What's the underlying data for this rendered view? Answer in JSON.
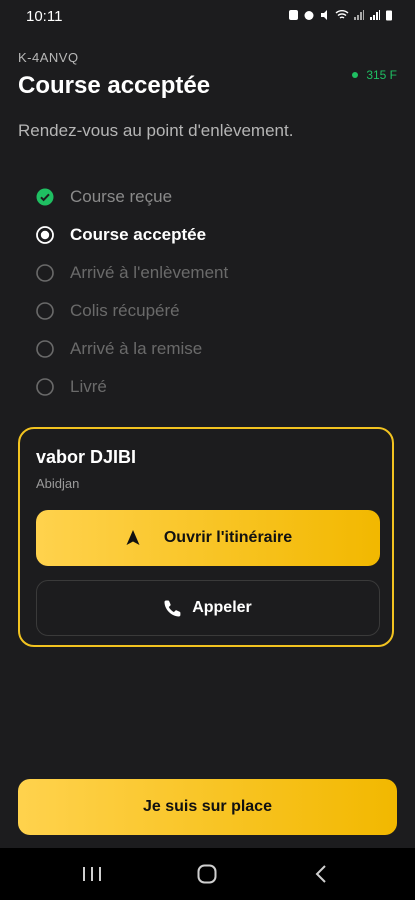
{
  "status_bar": {
    "time": "10:11"
  },
  "header": {
    "reference": "K-4ANVQ",
    "title": "Course acceptée",
    "balance": "315 F",
    "subtitle": "Rendez-vous au point d'enlèvement."
  },
  "steps": [
    {
      "label": "Course reçue",
      "state": "done"
    },
    {
      "label": "Course acceptée",
      "state": "current"
    },
    {
      "label": "Arrivé à l'enlèvement",
      "state": "todo"
    },
    {
      "label": "Colis récupéré",
      "state": "todo"
    },
    {
      "label": "Arrivé à la remise",
      "state": "todo"
    },
    {
      "label": "Livré",
      "state": "todo"
    }
  ],
  "contact": {
    "name": "vabor DJIBI",
    "city": "Abidjan",
    "route_label": "Ouvrir l'itinéraire",
    "call_label": "Appeler"
  },
  "actions": {
    "on_site_label": "Je suis sur place"
  },
  "colors": {
    "accent": "#f2c320",
    "success": "#1fbf62",
    "background": "#1c1c1e"
  },
  "icons": [
    "check-circle-icon",
    "radio-selected-icon",
    "radio-empty-icon",
    "navigation-arrow-icon",
    "phone-icon",
    "recent-apps-icon",
    "home-icon",
    "back-icon"
  ]
}
